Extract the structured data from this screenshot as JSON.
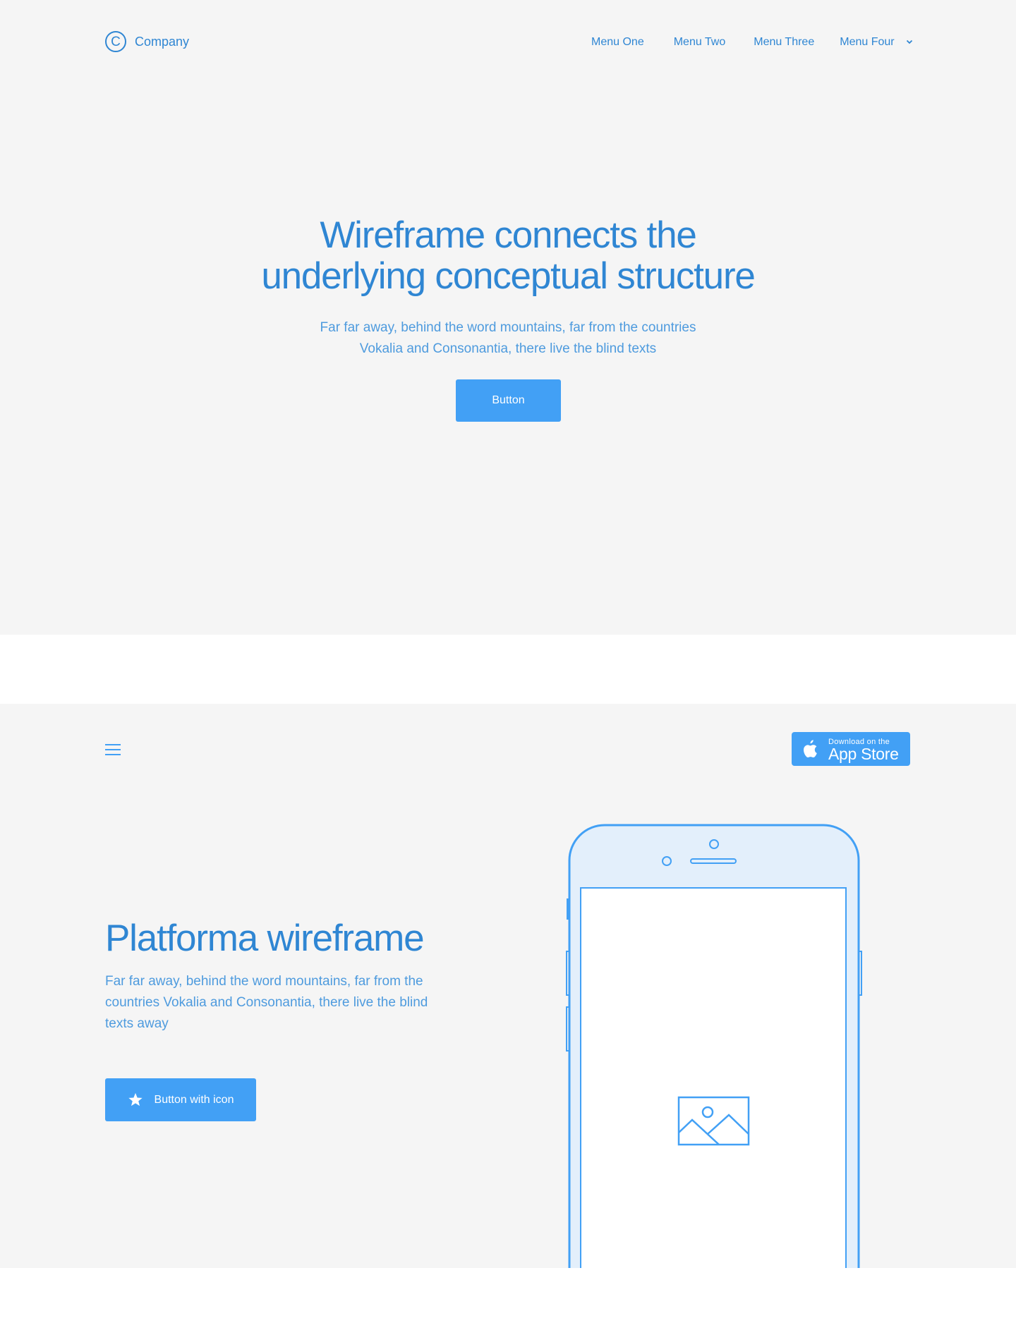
{
  "header": {
    "logo_letter": "C",
    "logo_text": "Company",
    "nav": [
      {
        "label": "Menu One"
      },
      {
        "label": "Menu Two"
      },
      {
        "label": "Menu Three"
      },
      {
        "label": "Menu Four",
        "has_dropdown": true
      }
    ]
  },
  "hero": {
    "title_lines": [
      "Wireframe connects the",
      "underlying conceptual structure"
    ],
    "subtitle_lines": [
      "Far far away, behind the word mountains, far from the countries",
      "Vokalia and Consonantia, there live the blind texts"
    ],
    "button_label": "Button"
  },
  "section2": {
    "appstore": {
      "small": "Download on the",
      "big": "App Store"
    },
    "title": "Platforma wireframe",
    "description_lines": [
      "Far far away, behind the word mountains, far from the",
      "countries Vokalia and Consonantia, there live the blind",
      "texts away"
    ],
    "button_label": "Button with icon",
    "button_icon": "star-icon"
  },
  "colors": {
    "accent": "#42a0f5",
    "text": "#2f86d3",
    "text_light": "#4e9bde",
    "section_bg": "#f5f5f5",
    "phone_fill": "#e3effb"
  }
}
